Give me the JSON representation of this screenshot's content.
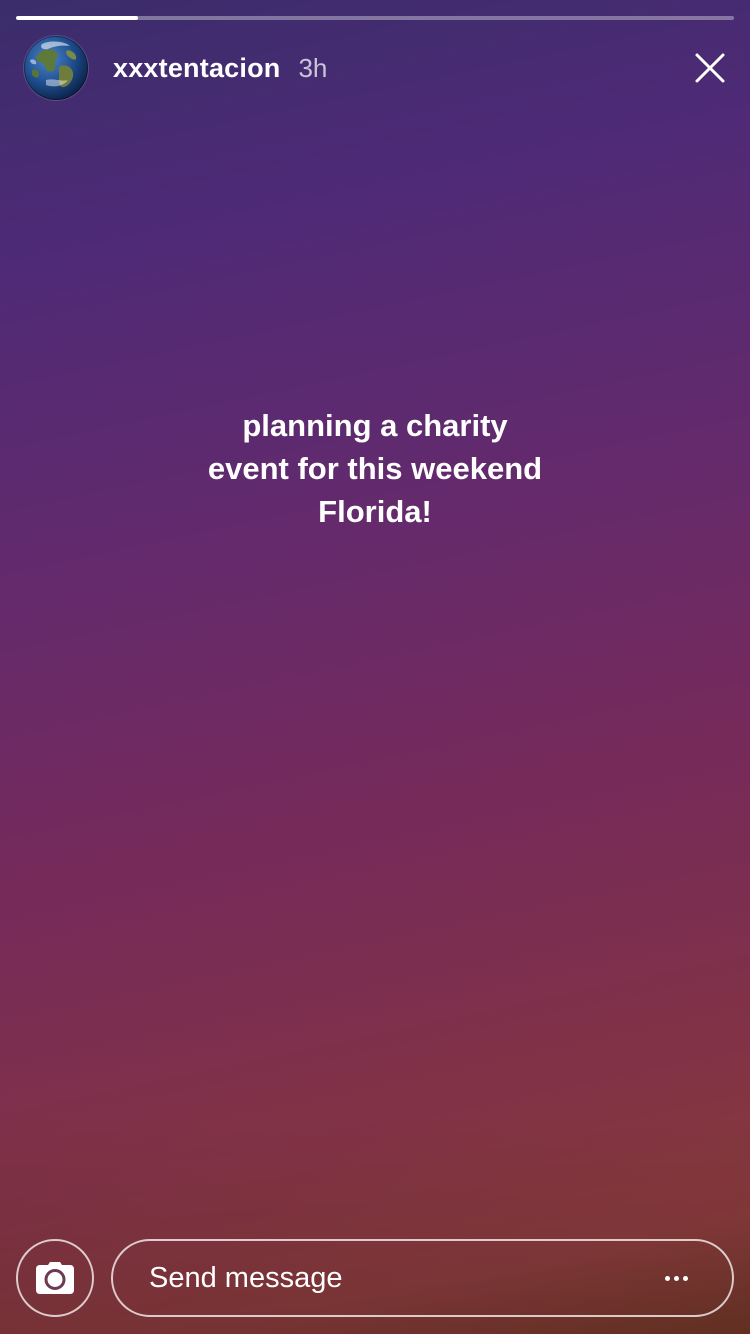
{
  "story": {
    "progress_fraction": 0.17,
    "user": {
      "username": "xxxtentacion",
      "time_ago": "3h",
      "avatar_icon": "earth-globe-avatar"
    },
    "close_icon": "close-icon",
    "text_lines": [
      "planning a charity",
      "event for this weekend",
      "Florida!"
    ],
    "colors": {
      "gradient_top": "#3a2d6b",
      "gradient_mid": "#762a5a",
      "gradient_bottom": "#6e3626",
      "text": "#ffffff"
    }
  },
  "footer": {
    "camera_icon": "camera-icon",
    "message_placeholder": "Send message",
    "more_icon": "more-horizontal-icon"
  }
}
